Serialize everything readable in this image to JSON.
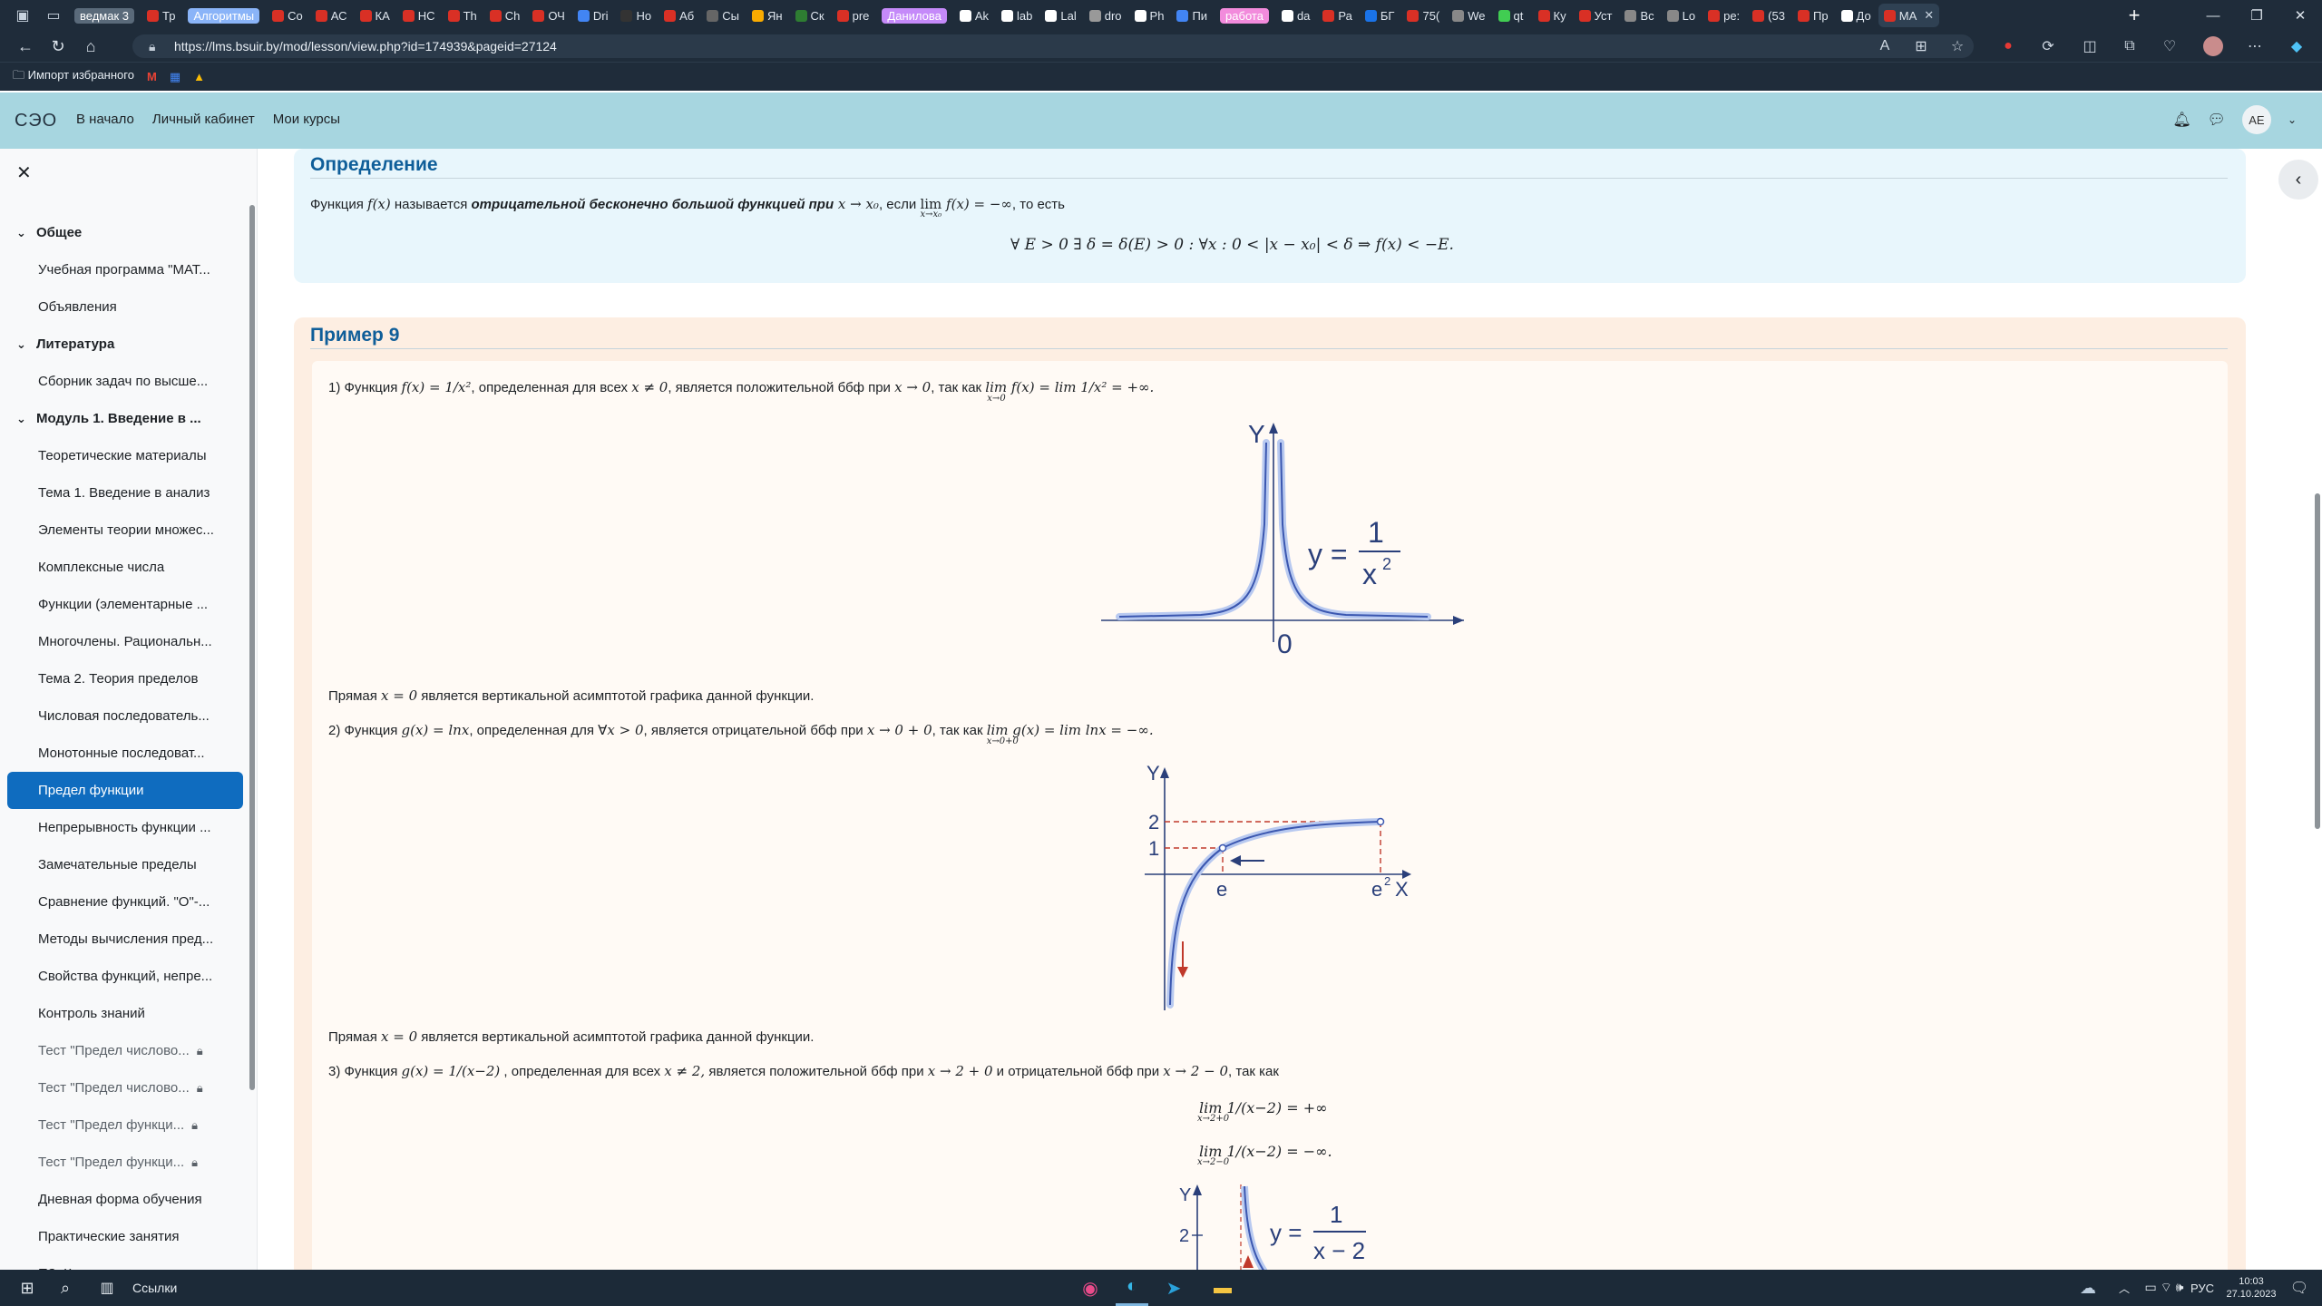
{
  "browser": {
    "tabs": [
      {
        "label": "ведмак 3",
        "color": "#5a6a7a",
        "pill": true
      },
      {
        "label": "Тр",
        "color": "#d93025"
      },
      {
        "label": "Алгоритмы",
        "color": "#8ab4f8",
        "pill": true
      },
      {
        "label": "Co",
        "color": "#d93025"
      },
      {
        "label": "АС",
        "color": "#d93025"
      },
      {
        "label": "КА",
        "color": "#d93025"
      },
      {
        "label": "НС",
        "color": "#d93025"
      },
      {
        "label": "Th",
        "color": "#d93025"
      },
      {
        "label": "Ch",
        "color": "#d93025"
      },
      {
        "label": "ОЧ",
        "color": "#d93025"
      },
      {
        "label": "Dri",
        "color": "#4285f4"
      },
      {
        "label": "Но",
        "color": "#333"
      },
      {
        "label": "Аб",
        "color": "#d93025"
      },
      {
        "label": "Сы",
        "color": "#666"
      },
      {
        "label": "Ян",
        "color": "#f9ab00"
      },
      {
        "label": "Ск",
        "color": "#2e7d32"
      },
      {
        "label": "pre",
        "color": "#d93025"
      },
      {
        "label": "Данилова",
        "color": "#c58af9",
        "pill": true
      },
      {
        "label": "Ak",
        "color": "#fff"
      },
      {
        "label": "lab",
        "color": "#fff"
      },
      {
        "label": "Lal",
        "color": "#fff"
      },
      {
        "label": "dro",
        "color": "#999"
      },
      {
        "label": "Ph",
        "color": "#fff"
      },
      {
        "label": "Пи",
        "color": "#4285f4"
      },
      {
        "label": "работа",
        "color": "#f28bdc",
        "pill": true
      },
      {
        "label": "da",
        "color": "#fff"
      },
      {
        "label": "Ра",
        "color": "#d93025"
      },
      {
        "label": "БГ",
        "color": "#1a73e8"
      },
      {
        "label": "75(",
        "color": "#d93025"
      },
      {
        "label": "We",
        "color": "#888"
      },
      {
        "label": "qt",
        "color": "#41cd52"
      },
      {
        "label": "Ку",
        "color": "#d93025"
      },
      {
        "label": "Уст",
        "color": "#d93025"
      },
      {
        "label": "Вс",
        "color": "#888"
      },
      {
        "label": "Lo",
        "color": "#888"
      },
      {
        "label": "pe:",
        "color": "#d93025"
      },
      {
        "label": "(53",
        "color": "#d93025"
      },
      {
        "label": "Пр",
        "color": "#d93025"
      },
      {
        "label": "До",
        "color": "#fff"
      },
      {
        "label": "МА",
        "color": "#d93025",
        "active": true
      }
    ],
    "url": "https://lms.bsuir.by/mod/lesson/view.php?id=174939&pageid=27124",
    "favorites_import": "Импорт избранного"
  },
  "site": {
    "logo": "СЭО",
    "nav": [
      "В начало",
      "Личный кабинет",
      "Мои курсы"
    ],
    "avatar": "АЕ"
  },
  "sidebar": {
    "items": [
      {
        "type": "section",
        "label": "Общее"
      },
      {
        "type": "item",
        "label": "Учебная программа \"МАТ..."
      },
      {
        "type": "item",
        "label": "Объявления"
      },
      {
        "type": "section",
        "label": "Литература"
      },
      {
        "type": "item",
        "label": "Сборник задач по высше..."
      },
      {
        "type": "section",
        "label": "Модуль 1. Введение в ..."
      },
      {
        "type": "item",
        "label": "Теоретические материалы"
      },
      {
        "type": "item",
        "label": "Тема 1. Введение в анализ"
      },
      {
        "type": "item",
        "label": "Элементы теории множес..."
      },
      {
        "type": "item",
        "label": "Комплексные числа"
      },
      {
        "type": "item",
        "label": "Функции (элементарные ..."
      },
      {
        "type": "item",
        "label": "Многочлены. Рациональн..."
      },
      {
        "type": "item",
        "label": "Тема 2. Теория пределов"
      },
      {
        "type": "item",
        "label": "Числовая последователь..."
      },
      {
        "type": "item",
        "label": "Монотонные последоват..."
      },
      {
        "type": "item",
        "label": "Предел функции",
        "active": true
      },
      {
        "type": "item",
        "label": "Непрерывность функции ..."
      },
      {
        "type": "item",
        "label": "Замечательные пределы"
      },
      {
        "type": "item",
        "label": "Сравнение функций. \"О\"-..."
      },
      {
        "type": "item",
        "label": "Методы вычисления пред..."
      },
      {
        "type": "item",
        "label": "Свойства функций, непре..."
      },
      {
        "type": "item",
        "label": "Контроль знаний"
      },
      {
        "type": "item",
        "label": "Тест \"Предел числово...",
        "locked": true
      },
      {
        "type": "item",
        "label": "Тест \"Предел числово...",
        "locked": true
      },
      {
        "type": "item",
        "label": "Тест \"Предел функци...",
        "locked": true
      },
      {
        "type": "item",
        "label": "Тест \"Предел функци...",
        "locked": true
      },
      {
        "type": "item",
        "label": "Дневная форма обучения"
      },
      {
        "type": "item",
        "label": "Практические занятия"
      },
      {
        "type": "item",
        "label": "ПЗ. Комплексные числа"
      }
    ]
  },
  "definition": {
    "title": "Определение",
    "text_prefix": "Функция ",
    "fx": "f(x)",
    "text_mid": " называется ",
    "bold": "отрицательной бесконечно большой функцией при",
    "cond": " x → x₀",
    "text_if": ", если ",
    "lim_main": "lim",
    "lim_sub": "x→x₀",
    "lim_rest": " f(x) = −∞",
    "text_end": ", то есть",
    "formula": "∀ E > 0   ∃ δ = δ(E) > 0 :   ∀x :   0 < |x − x₀| < δ ⇒ f(x) < −E."
  },
  "example": {
    "title": "Пример 9",
    "p1": {
      "a": "1) Функция ",
      "f": "f(x) = 1/x²",
      "b": ", определенная для всех ",
      "c": "x ≠ 0",
      "d": ", является положительной ббф при ",
      "e": "x → 0",
      "g": ", так как ",
      "h": "lim f(x) = lim 1/x² = +∞.",
      "sub": "x→0"
    },
    "graph1": {
      "ylabel": "Y",
      "origin": "0",
      "eq_left": "y =",
      "eq_num": "1",
      "eq_den": "x",
      "eq_pow": "2"
    },
    "p1_note_a": "Прямая ",
    "p1_note_m": "x = 0",
    "p1_note_b": " является вертикальной асимптотой графика данной функции.",
    "p2": {
      "a": "2) Функция ",
      "f": "g(x) = lnx",
      "b": ", определенная для ∀",
      "c": "x > 0",
      "d": ", является отрицательной ббф при ",
      "e": "x → 0 + 0",
      "g": ", так как ",
      "h": "lim g(x) = lim lnx = −∞.",
      "sub": "x→0+0"
    },
    "graph2": {
      "ylabel": "Y",
      "xlabel": "X",
      "y2": "2",
      "y1": "1",
      "xe": "e",
      "xe2": "e",
      "xe2pow": "2"
    },
    "p2_note_a": "Прямая ",
    "p2_note_m": "x = 0",
    "p2_note_b": " является вертикальной асимптотой графика данной функции.",
    "p3": {
      "a": "3) Функция ",
      "f": "g(x) = 1/(x−2)",
      "b": " , определенная для всех ",
      "c": "x ≠ 2,",
      "d": " является положительной ббф при ",
      "e": "x → 2 + 0",
      "g": "  и отрицательной ббф при ",
      "h": "x → 2 − 0",
      "i": ", так как"
    },
    "lim3a": "lim  1/(x−2) = +∞",
    "lim3a_sub": "x→2+0",
    "lim3b": "lim  1/(x−2) = −∞.",
    "lim3b_sub": "x→2−0",
    "graph3": {
      "ylabel": "Y",
      "y2": "2",
      "eq_left": "y =",
      "eq_num": "1",
      "eq_den": "x − 2"
    }
  },
  "taskbar": {
    "search_label": "Ссылки",
    "lang": "РУС",
    "time": "10:03",
    "date": "27.10.2023"
  }
}
